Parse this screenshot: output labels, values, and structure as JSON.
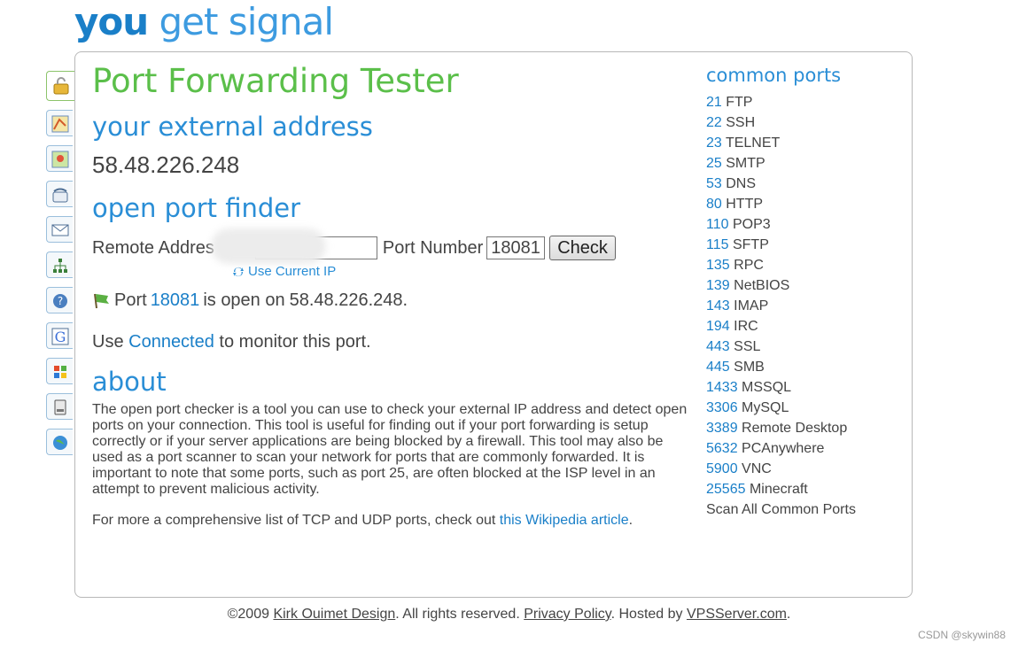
{
  "logo": {
    "you": "you",
    "rest": " get signal"
  },
  "sidebar": {
    "icons": [
      "lock-icon",
      "map-icon",
      "map-location-icon",
      "phone-icon",
      "envelope-icon",
      "network-icon",
      "help-icon",
      "google-icon",
      "windows-icon",
      "server-icon",
      "globe-icon"
    ]
  },
  "main": {
    "title": "Port Forwarding Tester",
    "external_heading": "your external address",
    "external_ip": "58.48.226.248",
    "finder_heading": "open port finder",
    "remote_label": "Remote Addres",
    "remote_value": "48",
    "port_label": "Port Number",
    "port_value": "18081",
    "check_button": "Check",
    "use_current_ip": "Use Current IP",
    "result": {
      "prefix": "Port ",
      "port": "18081",
      "middle": " is open on ",
      "ip": "58.48.226.248",
      "suffix": "."
    },
    "monitor": {
      "prefix": "Use ",
      "link": "Connected",
      "suffix": " to monitor this port."
    },
    "about_heading": "about",
    "about_text": "The open port checker is a tool you can use to check your external IP address and detect open ports on your connection. This tool is useful for finding out if your port forwarding is setup correctly or if your server applications are being blocked by a firewall. This tool may also be used as a port scanner to scan your network for ports that are commonly forwarded. It is important to note that some ports, such as port 25, are often blocked at the ISP level in an attempt to prevent malicious activity.",
    "more": {
      "prefix": "For more a comprehensive list of TCP and UDP ports, check out ",
      "link": "this Wikipedia article",
      "suffix": "."
    }
  },
  "ports": {
    "title": "common ports",
    "items": [
      {
        "num": "21",
        "name": "FTP"
      },
      {
        "num": "22",
        "name": "SSH"
      },
      {
        "num": "23",
        "name": "TELNET"
      },
      {
        "num": "25",
        "name": "SMTP"
      },
      {
        "num": "53",
        "name": "DNS"
      },
      {
        "num": "80",
        "name": "HTTP"
      },
      {
        "num": "110",
        "name": "POP3"
      },
      {
        "num": "115",
        "name": "SFTP"
      },
      {
        "num": "135",
        "name": "RPC"
      },
      {
        "num": "139",
        "name": "NetBIOS"
      },
      {
        "num": "143",
        "name": "IMAP"
      },
      {
        "num": "194",
        "name": "IRC"
      },
      {
        "num": "443",
        "name": "SSL"
      },
      {
        "num": "445",
        "name": "SMB"
      },
      {
        "num": "1433",
        "name": "MSSQL"
      },
      {
        "num": "3306",
        "name": "MySQL"
      },
      {
        "num": "3389",
        "name": "Remote Desktop"
      },
      {
        "num": "5632",
        "name": "PCAnywhere"
      },
      {
        "num": "5900",
        "name": "VNC"
      },
      {
        "num": "25565",
        "name": "Minecraft"
      }
    ],
    "scan_all": "Scan All Common Ports"
  },
  "footer": {
    "copyright": "©2009 ",
    "author": "Kirk Ouimet Design",
    "rights": ". All rights reserved. ",
    "privacy": "Privacy Policy",
    "hosted": ". Hosted by ",
    "host": "VPSServer.com",
    "end": "."
  },
  "watermark": "CSDN @skywin88",
  "colors": {
    "title_green": "#5bbf4a",
    "heading_blue": "#2a8ed6",
    "link_blue": "#1a7fc8"
  }
}
